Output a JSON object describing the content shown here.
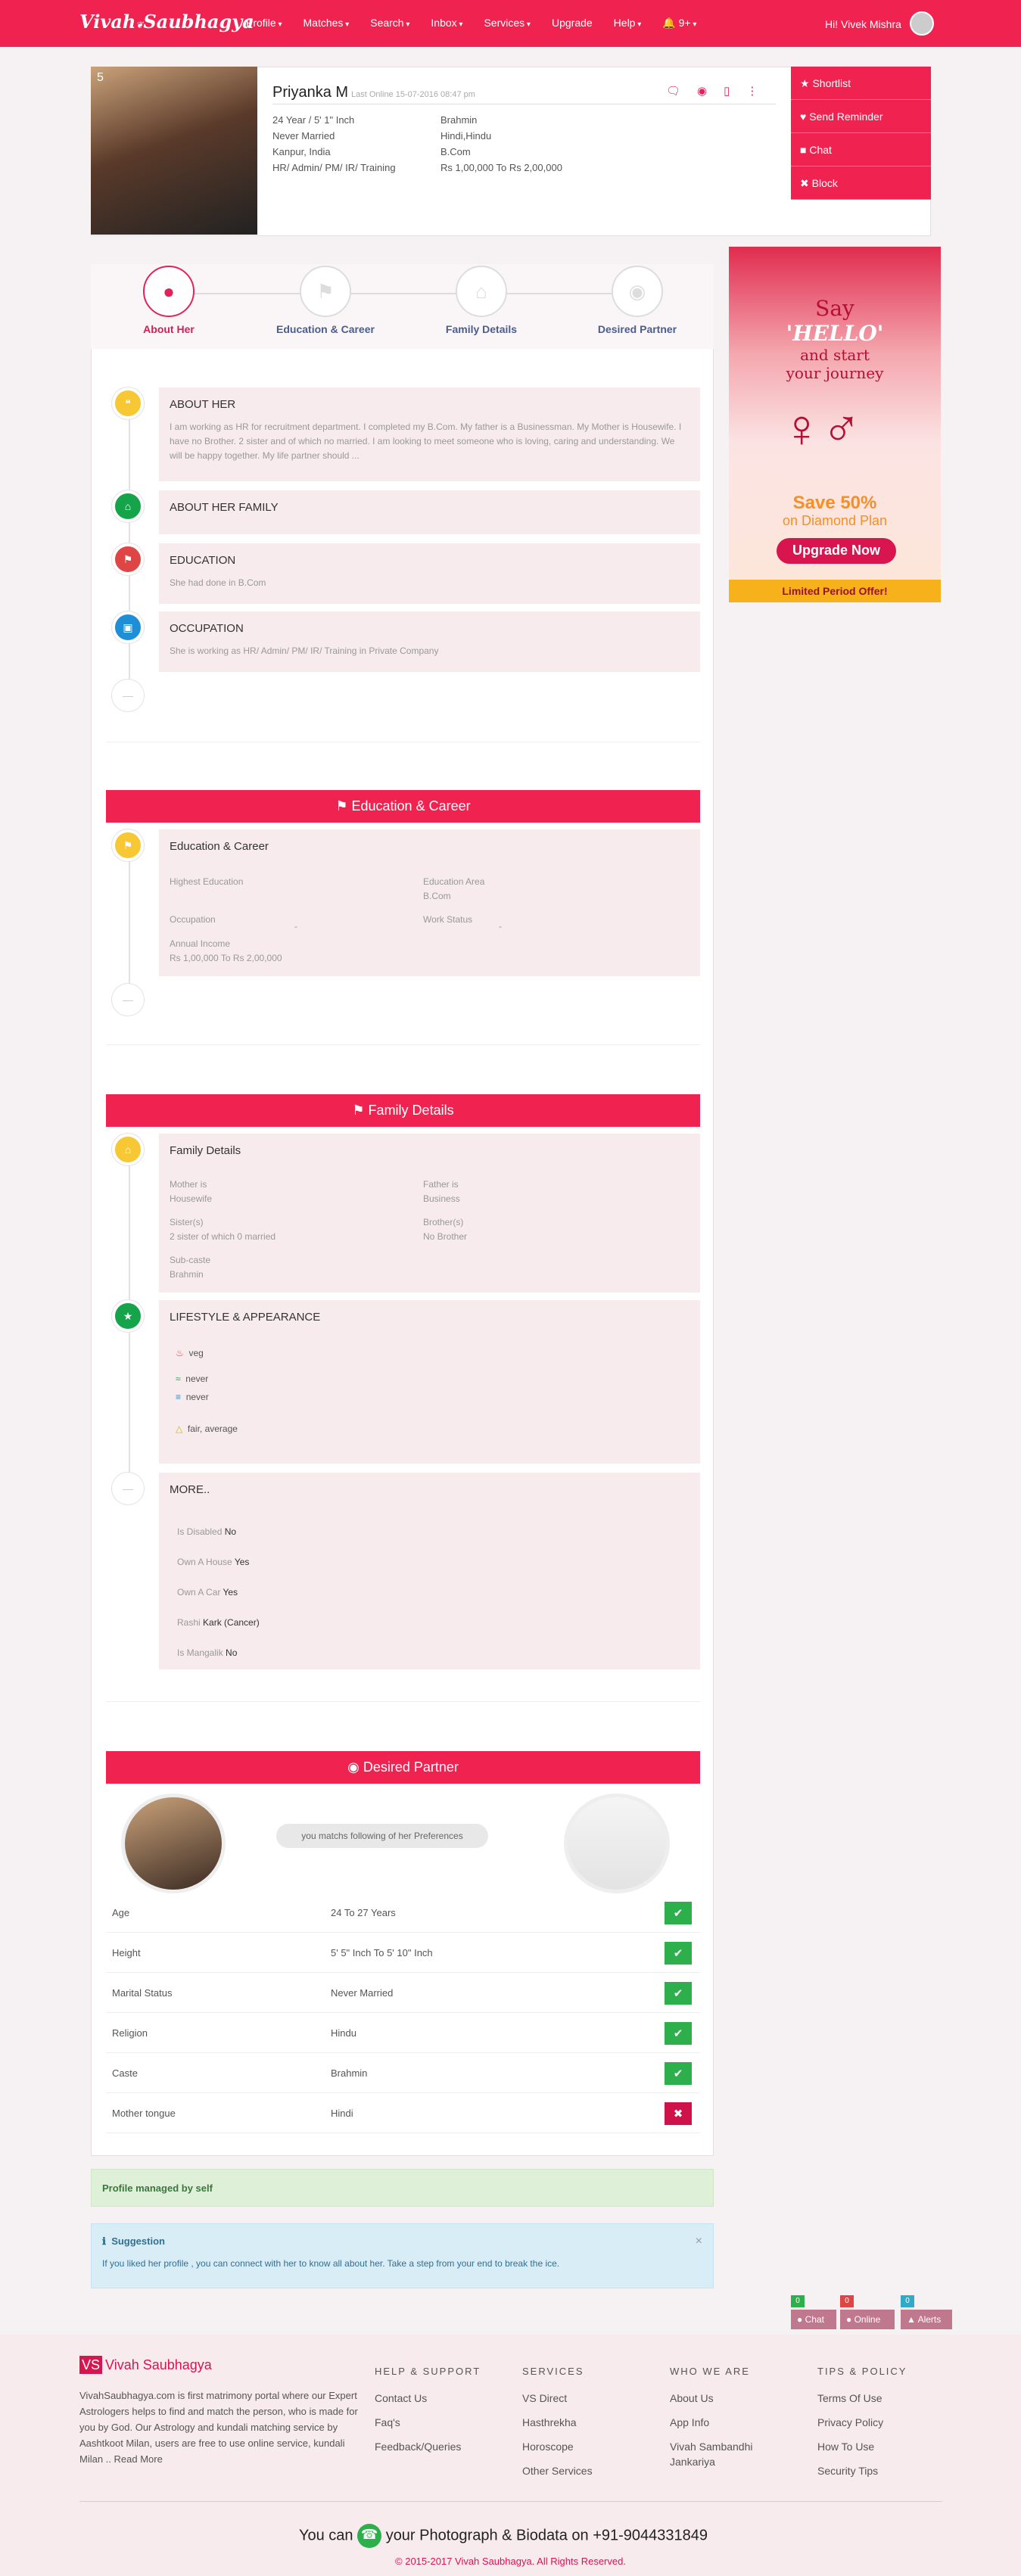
{
  "nav": {
    "logo": "Vivah",
    "logo_emblem": "❦",
    "logo2": "Saubhagya",
    "menu": [
      "Profile",
      "Matches",
      "Search",
      "Inbox",
      "Services",
      "Upgrade",
      "Help",
      "9+"
    ],
    "greeting": "Hi! Vivek Mishra"
  },
  "profile": {
    "photo_count": "5",
    "name": "Priyanka M",
    "last_online": "Last Online 15-07-2016 08:47 pm",
    "left": [
      "24 Year / 5' 1\" Inch",
      "Never Married",
      "Kanpur, India",
      "HR/ Admin/ PM/ IR/ Training"
    ],
    "right": [
      "Brahmin",
      "Hindi,Hindu",
      "B.Com",
      "Rs 1,00,000 To Rs 2,00,000"
    ]
  },
  "actions": [
    "★  Shortlist",
    "♥  Send Reminder",
    "■  Chat",
    "✖  Block"
  ],
  "steps": [
    "About Her",
    "Education & Career",
    "Family Details",
    "Desired Partner"
  ],
  "about": {
    "title": "ABOUT HER",
    "text": "I am working as HR for recruitment department. I completed my B.Com. My father is a Businessman. My Mother is Housewife. I have no Brother. 2 sister and of which no married. I am looking to meet someone who is loving, caring and understanding. We will be happy together. My life partner should ...",
    "family_title": "ABOUT HER FAMILY",
    "edu_title": "EDUCATION",
    "edu_text": "She had done in B.Com",
    "occ_title": "OCCUPATION",
    "occ_text": "She is working as HR/ Admin/ PM/ IR/ Training in Private Company"
  },
  "edu": {
    "bar": "⚑  Education & Career",
    "title": "Education & Career",
    "highest_label": "Highest Education",
    "area_label": "Education Area",
    "area": "B.Com",
    "occ_label": "Occupation",
    "occ": "-",
    "ws_label": "Work Status",
    "ws": "-",
    "income_label": "Annual Income",
    "income": "Rs 1,00,000 To Rs 2,00,000"
  },
  "family": {
    "bar": "⚑  Family Details",
    "title": "Family Details",
    "mother_label": "Mother is",
    "mother": "Housewife",
    "father_label": "Father is",
    "father": "Business",
    "sister_label": "Sister(s)",
    "sister": "2 sister of which 0 married",
    "brother_label": "Brother(s)",
    "brother": "No Brother",
    "subcaste_label": "Sub-caste",
    "subcaste": "Brahmin",
    "lifestyle_title": "LIFESTYLE & APPEARANCE",
    "lifestyle": [
      "veg",
      "never",
      "never",
      "fair, average"
    ],
    "more_title": "MORE..",
    "more": [
      [
        "Is Disabled",
        "No"
      ],
      [
        "Own A House",
        "Yes"
      ],
      [
        "Own A Car",
        "Yes"
      ],
      [
        "Rashi",
        "Kark (Cancer)"
      ],
      [
        "Is Mangalik",
        "No"
      ]
    ]
  },
  "partner": {
    "bar": "◉  Desired Partner",
    "match_text": "you matchs following of her Preferences",
    "rows": [
      [
        "Age",
        "24 To 27 Years",
        "yes"
      ],
      [
        "Height",
        "5' 5\" Inch To 5' 10\" Inch",
        "yes"
      ],
      [
        "Marital Status",
        "Never Married",
        "yes"
      ],
      [
        "Religion",
        "Hindu",
        "yes"
      ],
      [
        "Caste",
        "Brahmin",
        "yes"
      ],
      [
        "Mother tongue",
        "Hindi",
        "no"
      ]
    ]
  },
  "managed": "Profile managed by self",
  "suggestion": {
    "title": "Suggestion",
    "text": "If you liked her profile , you can connect with her to know all about her. Take a step from your end to break the ice."
  },
  "ad": {
    "say": "Say",
    "hello": "'HELLO'",
    "start": "and start",
    "journey": "your journey",
    "save": "Save 50%",
    "plan": "on Diamond Plan",
    "cta": "Upgrade Now",
    "offer": "Limited Period Offer!"
  },
  "dock": [
    [
      "Chat",
      "0"
    ],
    [
      "Online",
      "0"
    ],
    [
      "Alerts",
      "0"
    ]
  ],
  "footer": {
    "brand_vs": "VS",
    "brand": "Vivah Saubhagya",
    "desc": "VivahSaubhagya.com is first matrimony portal where our Expert Astrologers helps to find and match the person, who is made for you by God. Our Astrology and kundali matching service by Aashtkoot Milan, users are free to use online service, kundali Milan .. Read More",
    "cols": [
      {
        "h": "HELP & SUPPORT",
        "items": [
          "Contact Us",
          "Faq's",
          "Feedback/Queries"
        ]
      },
      {
        "h": "SERVICES",
        "items": [
          "VS Direct",
          "Hasthrekha",
          "Horoscope",
          "Other Services"
        ]
      },
      {
        "h": "WHO WE ARE",
        "items": [
          "About Us",
          "App Info",
          "Vivah Sambandhi Jankariya"
        ]
      },
      {
        "h": "TIPS & POLICY",
        "items": [
          "Terms Of Use",
          "Privacy Policy",
          "How To Use",
          "Security Tips"
        ]
      }
    ],
    "you_can": "You can",
    "upload": "your Photograph & Biodata on +91-9044331849",
    "copyright": "© 2015-2017 Vivah Saubhagya. All Rights Reserved."
  }
}
